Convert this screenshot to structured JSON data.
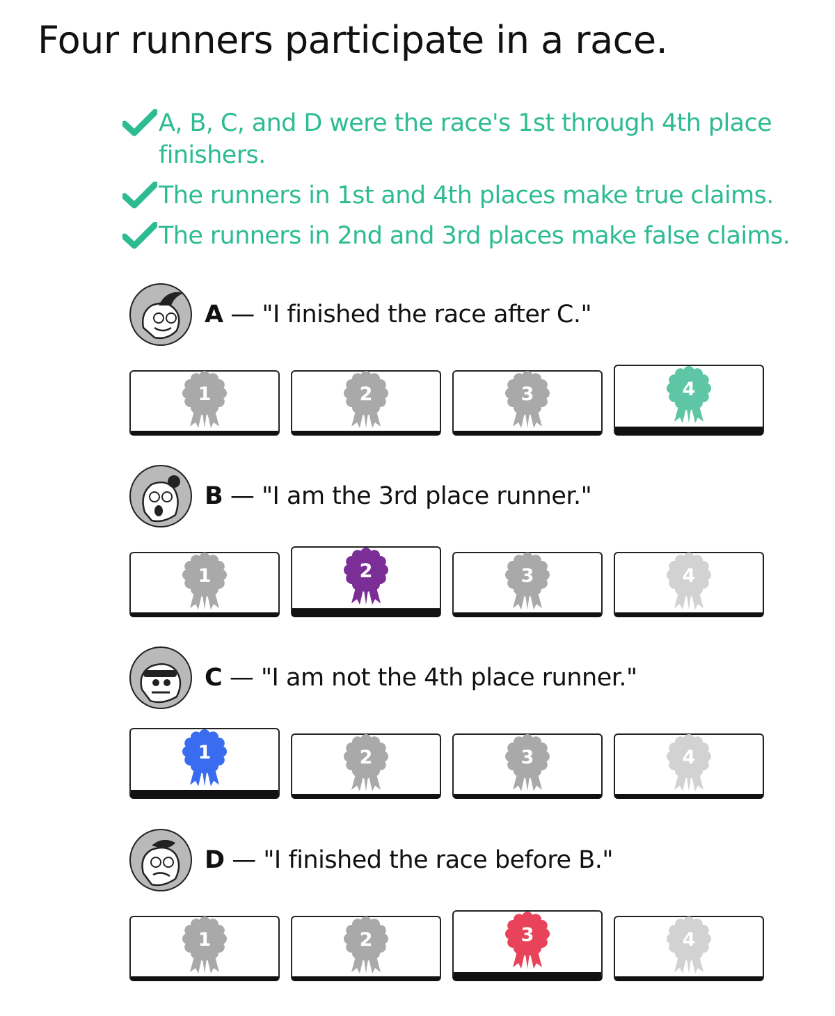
{
  "title": "Four runners participate in a race.",
  "claims": [
    "A, B, C, and D were the race's 1st through 4th place finishers.",
    "The runners in 1st and 4th places make true claims.",
    "The runners in 2nd and 3rd places make false claims."
  ],
  "colors": {
    "claim_green": "#2dbb92",
    "medal_inactive": "#a9a9a9",
    "medal_inactive_4": "#d2d2d2",
    "place_1": "#3a6cf0",
    "place_2": "#7a2e96",
    "place_3": "#e8435a",
    "place_4": "#5ec6a4"
  },
  "runners": [
    {
      "letter": "A",
      "dash": " — ",
      "quote": "\"I finished the race after C.\"",
      "selected": 4,
      "options": [
        {
          "label": "1"
        },
        {
          "label": "2"
        },
        {
          "label": "3"
        },
        {
          "label": "4"
        }
      ]
    },
    {
      "letter": "B",
      "dash": " — ",
      "quote": "\"I am the 3rd place runner.\"",
      "selected": 2,
      "options": [
        {
          "label": "1"
        },
        {
          "label": "2"
        },
        {
          "label": "3"
        },
        {
          "label": "4"
        }
      ]
    },
    {
      "letter": "C",
      "dash": " — ",
      "quote": "\"I am not the 4th place runner.\"",
      "selected": 1,
      "options": [
        {
          "label": "1"
        },
        {
          "label": "2"
        },
        {
          "label": "3"
        },
        {
          "label": "4"
        }
      ]
    },
    {
      "letter": "D",
      "dash": " — ",
      "quote": "\"I finished the race before B.\"",
      "selected": 3,
      "options": [
        {
          "label": "1"
        },
        {
          "label": "2"
        },
        {
          "label": "3"
        },
        {
          "label": "4"
        }
      ]
    }
  ]
}
